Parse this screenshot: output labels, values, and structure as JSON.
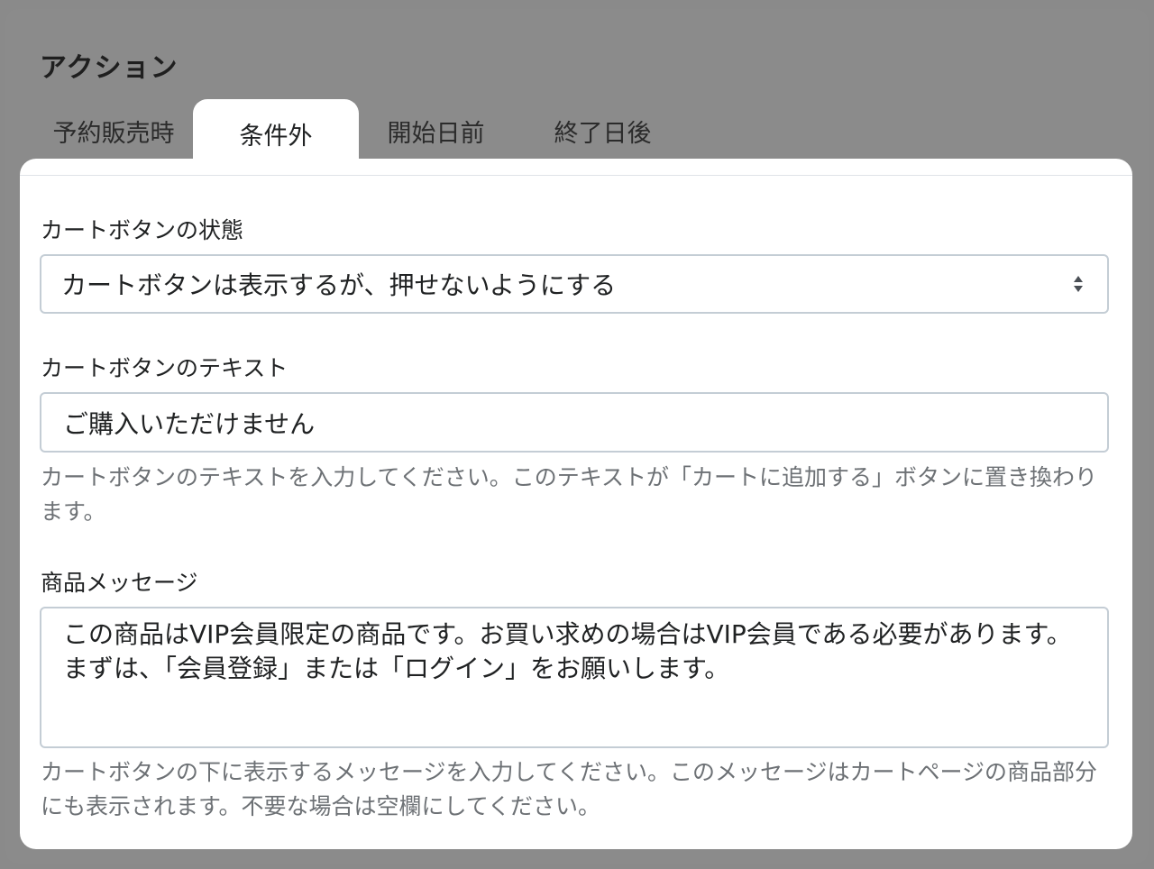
{
  "section": {
    "title": "アクション"
  },
  "tabs": [
    {
      "label": "予約販売時",
      "active": false
    },
    {
      "label": "条件外",
      "active": true
    },
    {
      "label": "開始日前",
      "active": false
    },
    {
      "label": "終了日後",
      "active": false
    }
  ],
  "accent_color": "#008060",
  "fields": {
    "cart_button_state": {
      "label": "カートボタンの状態",
      "selected": "カートボタンは表示するが、押せないようにする"
    },
    "cart_button_text": {
      "label": "カートボタンのテキスト",
      "value": "ご購入いただけません",
      "help": "カートボタンのテキストを入力してください。このテキストが「カートに追加する」ボタンに置き換わります。"
    },
    "product_message": {
      "label": "商品メッセージ",
      "value": "この商品はVIP会員限定の商品です。お買い求めの場合はVIP会員である必要があります。まずは、「会員登録」または「ログイン」をお願いします。",
      "help": "カートボタンの下に表示するメッセージを入力してください。このメッセージはカートページの商品部分にも表示されます。不要な場合は空欄にしてください。"
    }
  }
}
